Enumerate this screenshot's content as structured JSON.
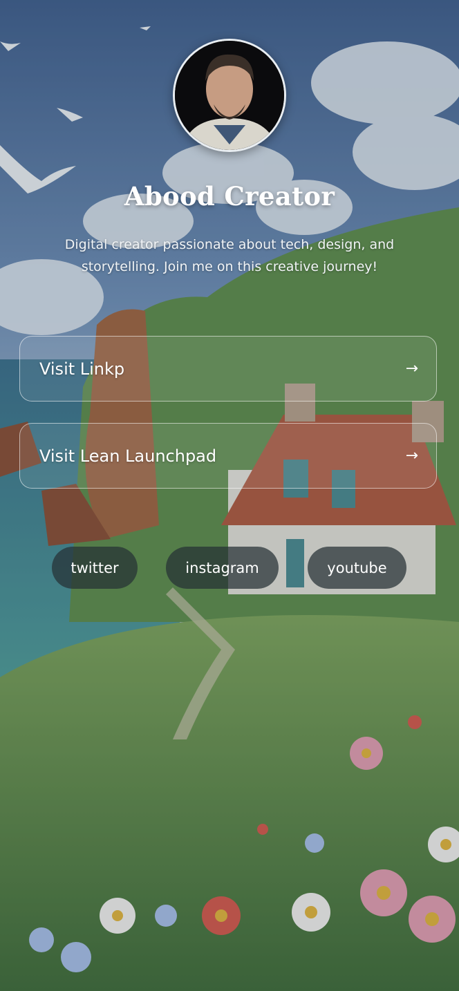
{
  "profile": {
    "name": "Abood Creator",
    "bio": "Digital creator passionate about tech, design, and storytelling. Join me on this creative journey!",
    "avatar_icon": "user-avatar-photo"
  },
  "links": [
    {
      "label": "Visit Linkp",
      "icon": "arrow-right-icon",
      "icon_glyph": "→"
    },
    {
      "label": "Visit Lean Launchpad",
      "icon": "arrow-right-icon",
      "icon_glyph": "→"
    }
  ],
  "social": [
    {
      "label": "twitter"
    },
    {
      "label": "instagram"
    },
    {
      "label": "youtube"
    }
  ],
  "theme": {
    "sky": "#4e6e9a",
    "grass": "#6f9a4c",
    "sea": "#3f8a8f",
    "roof": "#b05a3e",
    "pill_bg": "#263034"
  }
}
